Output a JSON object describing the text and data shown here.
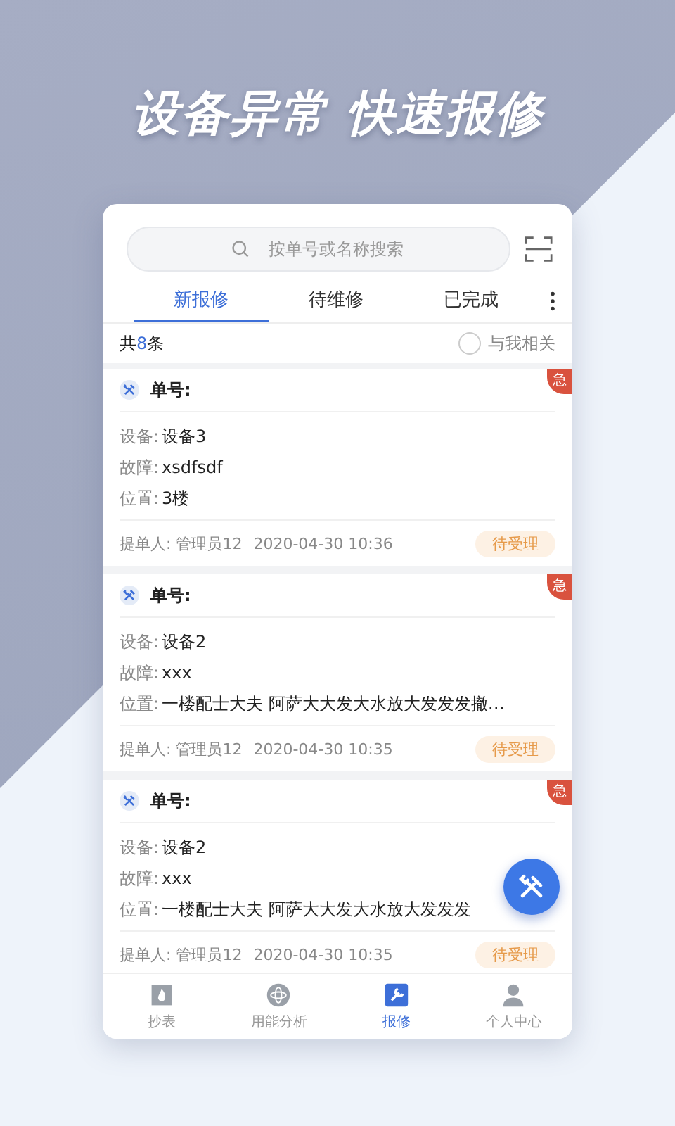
{
  "headline": "设备异常 快速报修",
  "search": {
    "placeholder": "按单号或名称搜索"
  },
  "tabs": [
    {
      "label": "新报修",
      "selected": true
    },
    {
      "label": "待维修",
      "selected": false
    },
    {
      "label": "已完成",
      "selected": false
    }
  ],
  "count": {
    "prefix": "共",
    "number": "8",
    "suffix": "条"
  },
  "related_filter": {
    "label": "与我相关",
    "checked": false
  },
  "orders": [
    {
      "title": "单号:",
      "urgent": "急",
      "fields": [
        {
          "label": "设备:",
          "value": "设备3"
        },
        {
          "label": "故障:",
          "value": "xsdfsdf"
        },
        {
          "label": "位置:",
          "value": "3楼"
        }
      ],
      "submitter": "提单人: 管理员12",
      "time": "2020-04-30 10:36",
      "status": "待受理"
    },
    {
      "title": "单号:",
      "urgent": "急",
      "fields": [
        {
          "label": "设备:",
          "value": "设备2"
        },
        {
          "label": "故障:",
          "value": "xxx"
        },
        {
          "label": "位置:",
          "value": "一楼配士大夫 阿萨大大发大水放大发发发撤…"
        }
      ],
      "submitter": "提单人: 管理员12",
      "time": "2020-04-30 10:35",
      "status": "待受理"
    },
    {
      "title": "单号:",
      "urgent": "急",
      "fields": [
        {
          "label": "设备:",
          "value": "设备2"
        },
        {
          "label": "故障:",
          "value": "xxx"
        },
        {
          "label": "位置:",
          "value": "一楼配士大夫 阿萨大大发大水放大发发发"
        }
      ],
      "submitter": "提单人: 管理员12",
      "time": "2020-04-30 10:35",
      "status": "待受理"
    }
  ],
  "nav": [
    {
      "kind": "meter",
      "label": "抄表",
      "selected": false
    },
    {
      "kind": "analysis",
      "label": "用能分析",
      "selected": false
    },
    {
      "kind": "repair",
      "label": "报修",
      "selected": true
    },
    {
      "kind": "profile",
      "label": "个人中心",
      "selected": false
    }
  ]
}
